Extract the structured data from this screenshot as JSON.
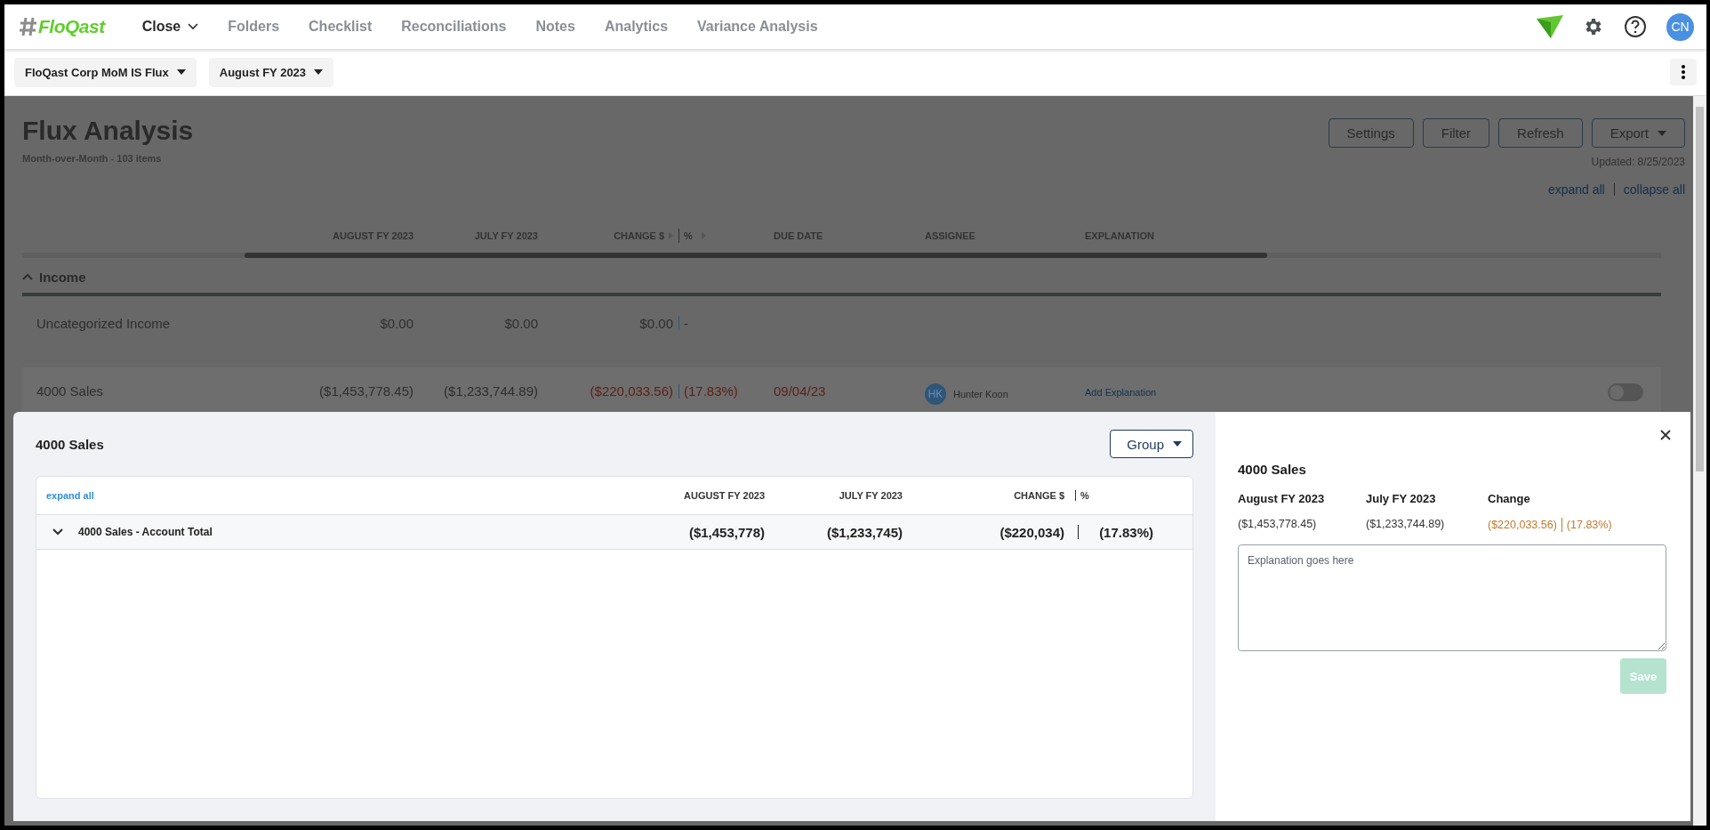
{
  "nav": {
    "logo": "FloQast",
    "items": [
      {
        "label": "Close",
        "selected": true,
        "has_menu": true
      },
      {
        "label": "Folders",
        "selected": false,
        "has_menu": false
      },
      {
        "label": "Checklist",
        "selected": false,
        "has_menu": false
      },
      {
        "label": "Reconciliations",
        "selected": false,
        "has_menu": false
      },
      {
        "label": "Notes",
        "selected": false,
        "has_menu": false
      },
      {
        "label": "Analytics",
        "selected": false,
        "has_menu": false
      },
      {
        "label": "Variance Analysis",
        "selected": false,
        "has_menu": false
      }
    ],
    "avatar": "CN"
  },
  "toolbar": {
    "dropdowns": [
      "FloQast Corp MoM IS Flux",
      "August FY 2023"
    ]
  },
  "page": {
    "title": "Flux Analysis",
    "subtitle": "Month-over-Month - 103 items",
    "buttons": [
      {
        "label": "Settings",
        "has_menu": false
      },
      {
        "label": "Filter",
        "has_menu": false
      },
      {
        "label": "Refresh",
        "has_menu": false
      },
      {
        "label": "Export",
        "has_menu": true
      }
    ],
    "updated": "Updated: 8/25/2023",
    "links": [
      "expand all",
      "collapse all"
    ]
  },
  "table": {
    "columns": {
      "august": "AUGUST FY 2023",
      "july": "JULY FY 2023",
      "change": "CHANGE $",
      "pct": "%",
      "due": "DUE DATE",
      "assignee": "ASSIGNEE",
      "explanation": "EXPLANATION"
    },
    "sections": [
      {
        "name": "Income",
        "expanded": true,
        "rows": [
          {
            "name": "Uncategorized Income",
            "august": "$0.00",
            "july": "$0.00",
            "change": "$0.00",
            "pct": "-",
            "negative": false
          },
          {
            "name": "4000 Sales",
            "august": "($1,453,778.45)",
            "july": "($1,233,744.89)",
            "change": "($220,033.56)",
            "pct": "(17.83%)",
            "negative": true,
            "due_date": "09/04/23",
            "overdue": true,
            "assignee": {
              "initials": "HK",
              "name": "Hunter Koon"
            },
            "explanation": "Add Explanation",
            "on": false
          }
        ]
      }
    ]
  },
  "drawer": {
    "title": "4000 Sales",
    "group_button": "Group",
    "table": {
      "expand_label": "expand all",
      "columns": [
        "AUGUST FY 2023",
        "JULY FY 2023",
        "CHANGE $",
        "%"
      ],
      "rows": [
        {
          "name": "4000 Sales - Account Total",
          "expanded": true,
          "august": "($1,453,778)",
          "july": "($1,233,745)",
          "change": "($220,034)",
          "pct": "(17.83%)"
        }
      ]
    },
    "detail": {
      "title": "4000 Sales",
      "columns": [
        {
          "label": "August FY 2023",
          "value": "($1,453,778.45)",
          "kind": "amount"
        },
        {
          "label": "July FY 2023",
          "value": "($1,233,744.89)",
          "kind": "amount"
        },
        {
          "label": "Change",
          "value": "($220,033.56)",
          "pct": "(17.83%)",
          "kind": "change"
        }
      ],
      "placeholder": "Explanation goes here",
      "save": {
        "label": "Save",
        "disabled": true
      }
    }
  }
}
